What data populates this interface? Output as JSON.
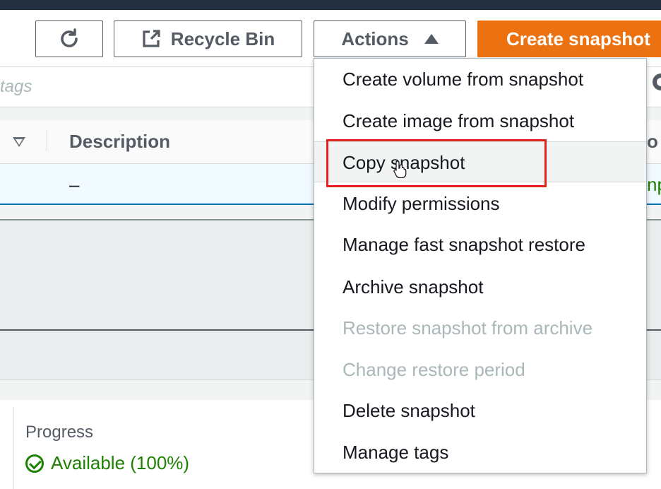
{
  "toolbar": {
    "refresh_icon": "refresh-icon",
    "recycle_bin_label": "Recycle Bin",
    "recycle_bin_icon": "external-link-icon",
    "actions_label": "Actions",
    "create_snapshot_label": "Create snapshot"
  },
  "search": {
    "placeholder": "tags"
  },
  "table": {
    "columns": [
      "Description"
    ],
    "row": {
      "description": "–",
      "right_fragment": "np"
    },
    "right_header_fragment": "o"
  },
  "details": {
    "progress_label": "Progress",
    "progress_status": "Available (100%)"
  },
  "actions_menu": {
    "items": [
      {
        "label": "Create volume from snapshot",
        "disabled": false
      },
      {
        "label": "Create image from snapshot",
        "disabled": false
      },
      {
        "label": "Copy snapshot",
        "disabled": false,
        "hovered": true
      },
      {
        "label": "Modify permissions",
        "disabled": false
      },
      {
        "label": "Manage fast snapshot restore",
        "disabled": false
      },
      {
        "label": "Archive snapshot",
        "disabled": false
      },
      {
        "label": "Restore snapshot from archive",
        "disabled": true
      },
      {
        "label": "Change restore period",
        "disabled": true
      },
      {
        "label": "Delete snapshot",
        "disabled": false
      },
      {
        "label": "Manage tags",
        "disabled": false
      }
    ]
  },
  "colors": {
    "primary_button": "#ec7211",
    "success": "#1d8102",
    "highlight_box": "#e1231e",
    "disabled_text": "#aab7b8"
  }
}
